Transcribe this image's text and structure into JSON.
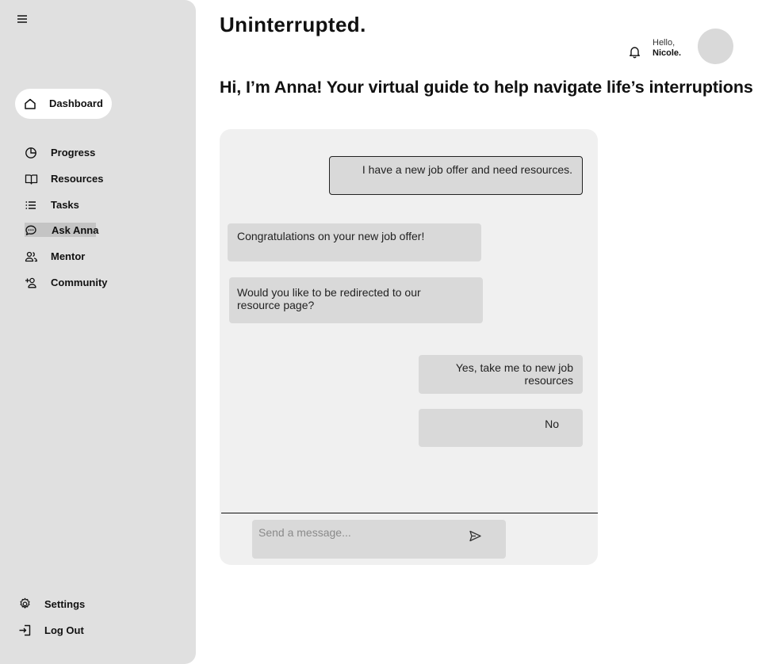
{
  "brand": {
    "logo_text": "Uninterrupted."
  },
  "sidebar": {
    "dashboard_label": "Dashboard",
    "items": [
      {
        "label": "Progress",
        "icon": "pie-chart-icon"
      },
      {
        "label": "Resources",
        "icon": "book-icon"
      },
      {
        "label": "Tasks",
        "icon": "list-icon"
      },
      {
        "label": "Ask Anna",
        "icon": "chat-icon",
        "active": true
      },
      {
        "label": "Mentor",
        "icon": "users-icon"
      },
      {
        "label": "Community",
        "icon": "user-plus-icon"
      }
    ],
    "footer": [
      {
        "label": "Settings",
        "icon": "gear-icon"
      },
      {
        "label": "Log Out",
        "icon": "logout-icon"
      }
    ]
  },
  "header": {
    "greeting": "Hello,",
    "user_name": "Nicole."
  },
  "page": {
    "headline": "Hi, I’m Anna! Your virtual guide to help navigate life’s interruptions"
  },
  "chat": {
    "messages": [
      {
        "from": "user",
        "text": "I have a new job offer and need resources."
      },
      {
        "from": "anna",
        "text": "Congratulations on your new job offer!"
      },
      {
        "from": "anna",
        "text": "Would you like to be redirected to our resource page?"
      },
      {
        "from": "user",
        "text": "Yes, take me to new job resources"
      },
      {
        "from": "user",
        "text": "No"
      }
    ],
    "input_placeholder": "Send a message..."
  },
  "colors": {
    "sidebar_bg": "#e0e0e0",
    "chat_bg": "#f0f0f0",
    "bubble_bg": "#d9d9d9",
    "text": "#111111"
  }
}
